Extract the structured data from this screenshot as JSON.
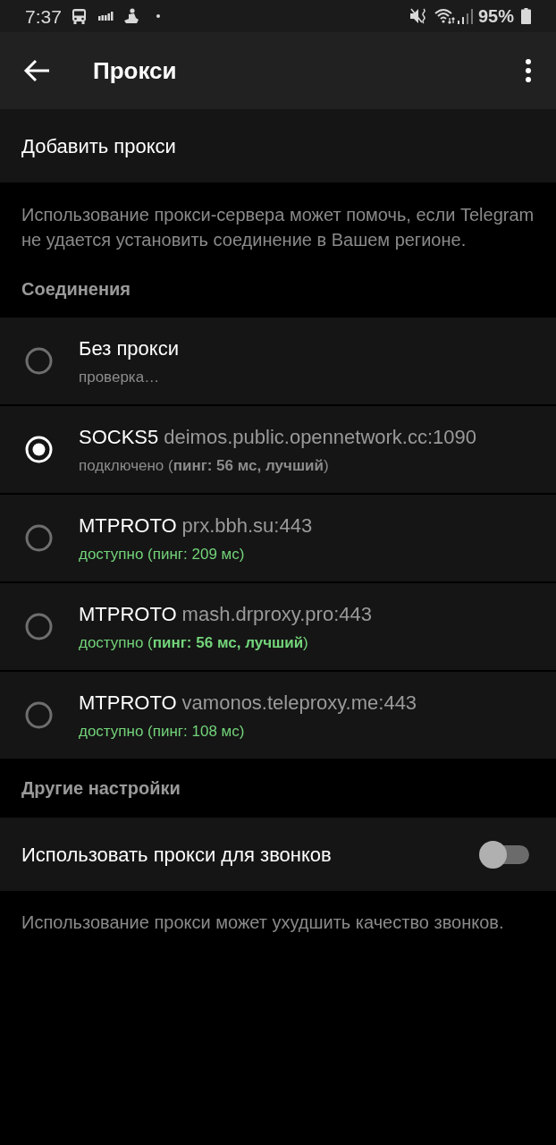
{
  "status_bar": {
    "time": "7:37",
    "battery": "95%"
  },
  "app_bar": {
    "title": "Прокси"
  },
  "add_proxy": {
    "label": "Добавить прокси"
  },
  "info_text": "Использование прокси-сервера может помочь, если Telegram не удается установить соединение в Вашем регионе.",
  "connections": {
    "header": "Соединения",
    "items": [
      {
        "kind": "direct",
        "title": "Без прокси",
        "status": "проверка…",
        "color": "#8c8c8c",
        "selected": false
      },
      {
        "kind": "proxy",
        "protocol": "SOCKS5",
        "address": "deimos.public.opennetwork.cc:1090",
        "status": "подключено (**пинг: 56 мс, лучший**)",
        "color": "#8c8c8c",
        "selected": true
      },
      {
        "kind": "proxy",
        "protocol": "MTPROTO",
        "address": "prx.bbh.su:443",
        "status": "доступно (пинг: 209 мс)",
        "color": "#73d47a",
        "selected": false
      },
      {
        "kind": "proxy",
        "protocol": "MTPROTO",
        "address": "mash.drproxy.pro:443",
        "status": "доступно (**пинг: 56 мс, лучший**)",
        "color": "#73d47a",
        "selected": false
      },
      {
        "kind": "proxy",
        "protocol": "MTPROTO",
        "address": "vamonos.teleproxy.me:443",
        "status": "доступно (пинг: 108 мс)",
        "color": "#73d47a",
        "selected": false
      }
    ]
  },
  "other_settings": {
    "header": "Другие настройки",
    "items": [
      {
        "label": "Использовать прокси для звонков",
        "on": false
      }
    ]
  },
  "footer_text": "Использование прокси может ухудшить качество звонков."
}
